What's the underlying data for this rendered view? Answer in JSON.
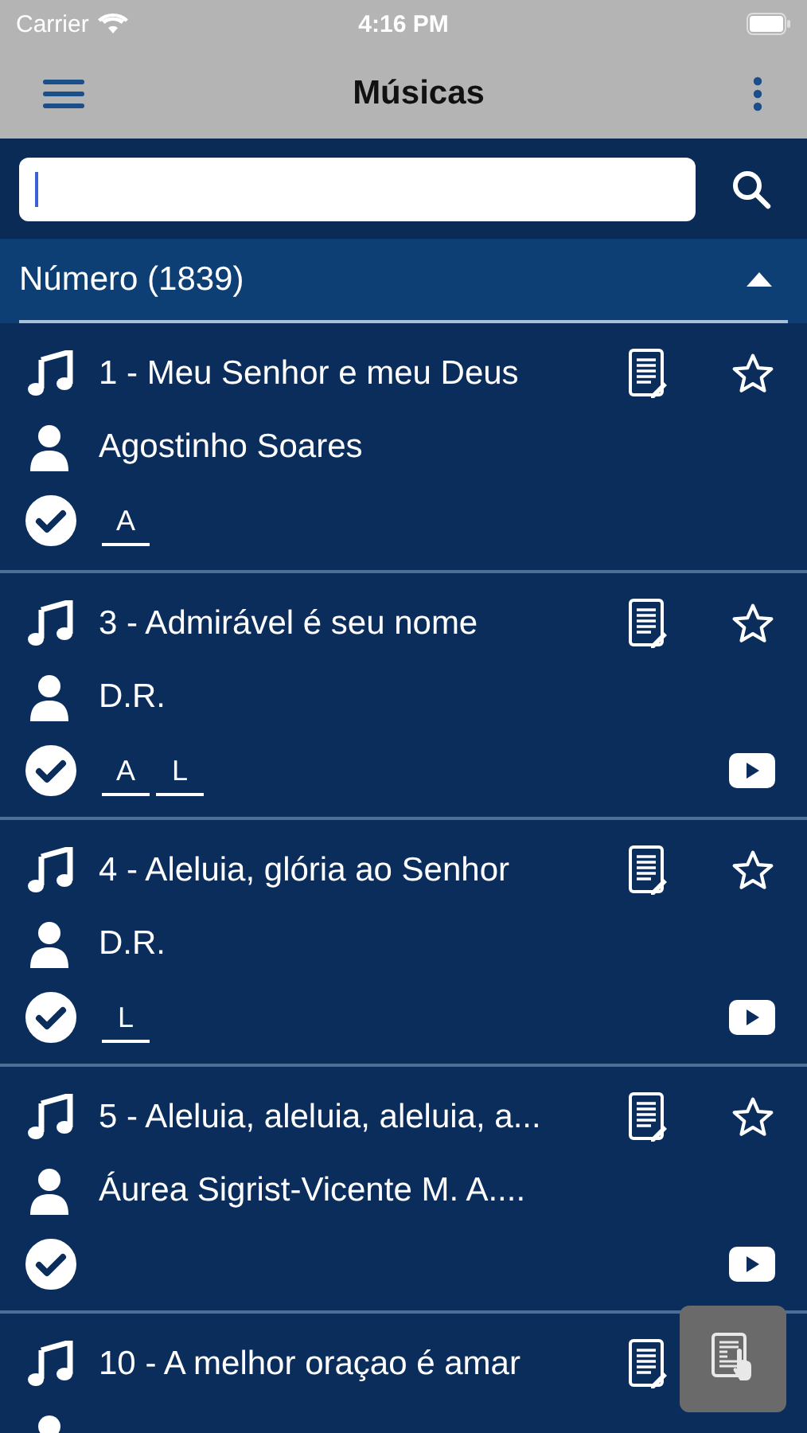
{
  "status_bar": {
    "carrier": "Carrier",
    "time": "4:16 PM"
  },
  "nav_bar": {
    "title": "Músicas"
  },
  "list_header": {
    "label": "Número (1839)",
    "expanded": true
  },
  "songs": [
    {
      "title": "1 - Meu Senhor e meu Deus",
      "author": "Agostinho Soares",
      "checked": true,
      "tags": [
        "A"
      ],
      "favorite": false,
      "video": false
    },
    {
      "title": "3 - Admirável é seu nome",
      "author": "D.R.",
      "checked": true,
      "tags": [
        "A",
        "L"
      ],
      "favorite": false,
      "video": true
    },
    {
      "title": "4 - Aleluia, glória ao Senhor",
      "author": "D.R.",
      "checked": true,
      "tags": [
        "L"
      ],
      "favorite": false,
      "video": true
    },
    {
      "title": "5 - Aleluia, aleluia, aleluia, a...",
      "author": "Áurea Sigrist-Vicente M. A....",
      "checked": true,
      "favorite": false,
      "video": true
    },
    {
      "title": "10 - A melhor oraçao é amar"
    }
  ]
}
